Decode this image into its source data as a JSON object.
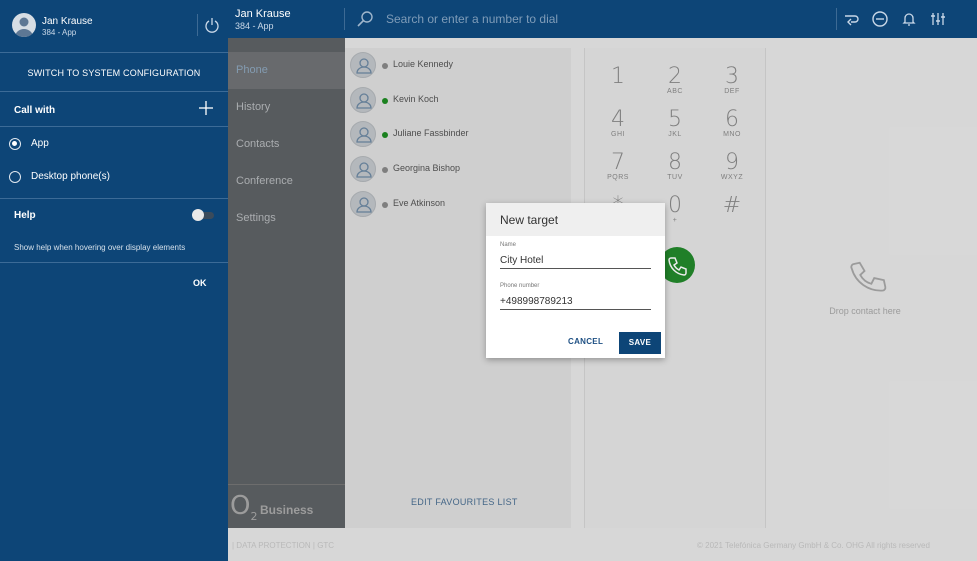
{
  "topbar": {
    "user_name": "Jan Krause",
    "user_sub": "384 - App",
    "search_placeholder": "Search or enter a number to dial",
    "icons": [
      "redirect-icon",
      "do-not-disturb-icon",
      "bell-icon",
      "sliders-icon"
    ]
  },
  "nav": {
    "items": [
      {
        "label": "Phone",
        "active": true
      },
      {
        "label": "History"
      },
      {
        "label": "Contacts"
      },
      {
        "label": "Conference"
      },
      {
        "label": "Settings"
      }
    ]
  },
  "logo": {
    "o2": "O",
    "o2_sub": "2",
    "business": "Business"
  },
  "contacts": [
    {
      "name": "Louie Kennedy",
      "status_color": "#8a8a8a"
    },
    {
      "name": "Kevin Koch",
      "status_color": "#1e8c22"
    },
    {
      "name": "Juliane Fassbinder",
      "status_color": "#1e8c22"
    },
    {
      "name": "Georgina Bishop",
      "status_color": "#8a8a8a"
    },
    {
      "name": "Eve Atkinson",
      "status_color": "#8a8a8a"
    }
  ],
  "edit_favourites": "EDIT FAVOURITES LIST",
  "dialpad": {
    "keys": [
      {
        "digit": "1",
        "letters": ""
      },
      {
        "digit": "2",
        "letters": "ABC"
      },
      {
        "digit": "3",
        "letters": "DEF"
      },
      {
        "digit": "4",
        "letters": "GHI"
      },
      {
        "digit": "5",
        "letters": "JKL"
      },
      {
        "digit": "6",
        "letters": "MNO"
      },
      {
        "digit": "7",
        "letters": "PQRS"
      },
      {
        "digit": "8",
        "letters": "TUV"
      },
      {
        "digit": "9",
        "letters": "WXYZ"
      },
      {
        "digit": "*",
        "letters": ""
      },
      {
        "digit": "0",
        "letters": "+"
      },
      {
        "digit": "#",
        "letters": ""
      }
    ]
  },
  "drop_contact": "Drop contact here",
  "footer": {
    "left": "| DATA PROTECTION | GTC",
    "right": "© 2021 Telefónica Germany GmbH & Co. OHG All rights reserved"
  },
  "panel": {
    "user_name": "Jan Krause",
    "user_sub": "384 - App",
    "switch_config": "SWITCH TO SYSTEM CONFIGURATION",
    "call_with": "Call with",
    "options": [
      {
        "label": "App",
        "selected": true
      },
      {
        "label": "Desktop phone(s)",
        "selected": false
      }
    ],
    "help_title": "Help",
    "help_toggle_on": false,
    "help_desc": "Show help when hovering over display elements",
    "ok": "OK"
  },
  "modal": {
    "title": "New target",
    "name_label": "Name",
    "name_value": "City Hotel",
    "phone_label": "Phone number",
    "phone_value": "+498998789213",
    "cancel": "CANCEL",
    "save": "SAVE"
  },
  "colors": {
    "brand_blue": "#0d4577",
    "online_green": "#1e8c22",
    "call_green": "#238a2c"
  }
}
